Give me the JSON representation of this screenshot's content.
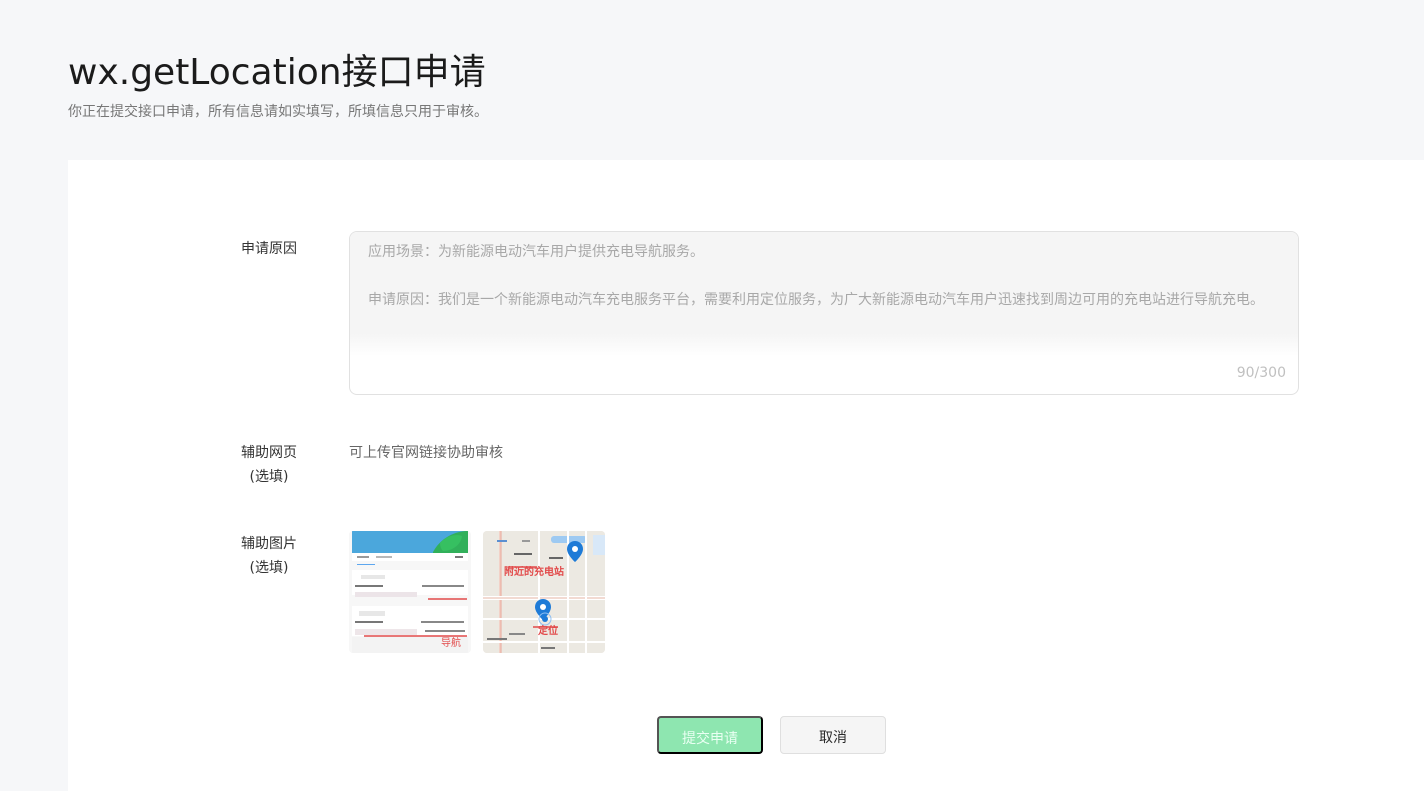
{
  "header": {
    "title": "wx.getLocation接口申请",
    "subtitle": "你正在提交接口申请，所有信息请如实填写，所填信息只用于审核。"
  },
  "form": {
    "reason": {
      "label": "申请原因",
      "value": "应用场景：为新能源电动汽车用户提供充电导航服务。\n\n申请原因：我们是一个新能源电动汽车充电服务平台，需要利用定位服务，为广大新能源电动汽车用户迅速找到周边可用的充电站进行导航充电。",
      "counter": "90/300"
    },
    "website": {
      "label_line1": "辅助网页",
      "label_line2": "(选填)",
      "helper": "可上传官网链接协助审核"
    },
    "images": {
      "label_line1": "辅助图片",
      "label_line2": "(选填)",
      "thumb1_annotation": "导航",
      "thumb2_annotation_nearby": "附近的充电站",
      "thumb2_annotation_locate": "定位"
    }
  },
  "actions": {
    "submit_label": "提交申请",
    "cancel_label": "取消"
  },
  "colors": {
    "primary_disabled": "#8ee6b0",
    "annotation_red": "#e24a4a",
    "map_pin_blue": "#1e7bd7"
  },
  "icons": {
    "location_pin": "map-pin-icon",
    "app_leaf": "leaf-icon"
  }
}
